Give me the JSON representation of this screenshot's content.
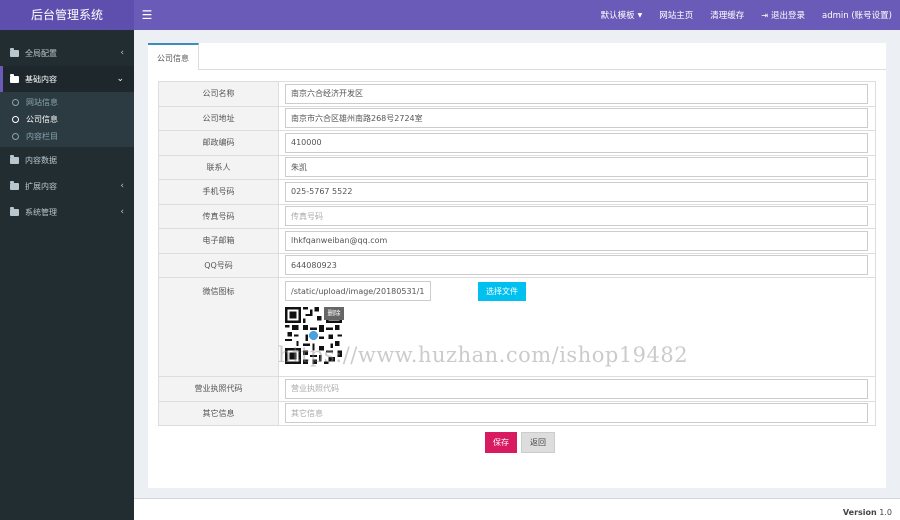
{
  "app": {
    "title": "后台管理系统"
  },
  "header": {
    "menu_icon": "hamburger-icon",
    "nav": [
      {
        "label": "默认模板",
        "icon": "caret-down-icon"
      },
      {
        "label": "网站主页"
      },
      {
        "label": "清理缓存"
      },
      {
        "label": "退出登录",
        "icon": "sign-out-icon"
      },
      {
        "label": "admin (账号设置)"
      }
    ]
  },
  "sidebar": {
    "items": [
      {
        "label": "全局配置"
      },
      {
        "label": "基础内容",
        "open": true,
        "children": [
          {
            "label": "网站信息"
          },
          {
            "label": "公司信息",
            "active": true
          },
          {
            "label": "内容栏目"
          }
        ]
      },
      {
        "label": "内容数据"
      },
      {
        "label": "扩展内容"
      },
      {
        "label": "系统管理"
      }
    ]
  },
  "main": {
    "tab": "公司信息",
    "fields": [
      {
        "label": "公司名称",
        "value": "南京六合经济开发区",
        "placeholder": ""
      },
      {
        "label": "公司地址",
        "value": "南京市六合区雄州南路268号2724室",
        "placeholder": ""
      },
      {
        "label": "邮政编码",
        "value": "410000",
        "placeholder": ""
      },
      {
        "label": "联系人",
        "value": "朱凯",
        "placeholder": ""
      },
      {
        "label": "手机号码",
        "value": "025-5767 5522",
        "placeholder": ""
      },
      {
        "label": "传真号码",
        "value": "",
        "placeholder": "传真号码"
      },
      {
        "label": "电子邮箱",
        "value": "lhkfqanweiban@qq.com",
        "placeholder": ""
      },
      {
        "label": "QQ号码",
        "value": "644080923",
        "placeholder": ""
      }
    ],
    "wechat": {
      "label": "微信图标",
      "value": "/static/upload/image/20180531/1",
      "upload_label": "选择文件",
      "delete_label": "删除"
    },
    "fields_after": [
      {
        "label": "营业执照代码",
        "value": "",
        "placeholder": "营业执照代码"
      },
      {
        "label": "其它信息",
        "value": "",
        "placeholder": "其它信息"
      }
    ],
    "save_label": "保存",
    "back_label": "返回"
  },
  "watermark": "https://www.huzhan.com/ishop19482",
  "footer": {
    "version_label": "Version",
    "version": "1.0"
  },
  "colors": {
    "header": "#6b5bb8",
    "sidebar": "#222d32",
    "upload": "#00c0ef",
    "save": "#d81b60"
  }
}
